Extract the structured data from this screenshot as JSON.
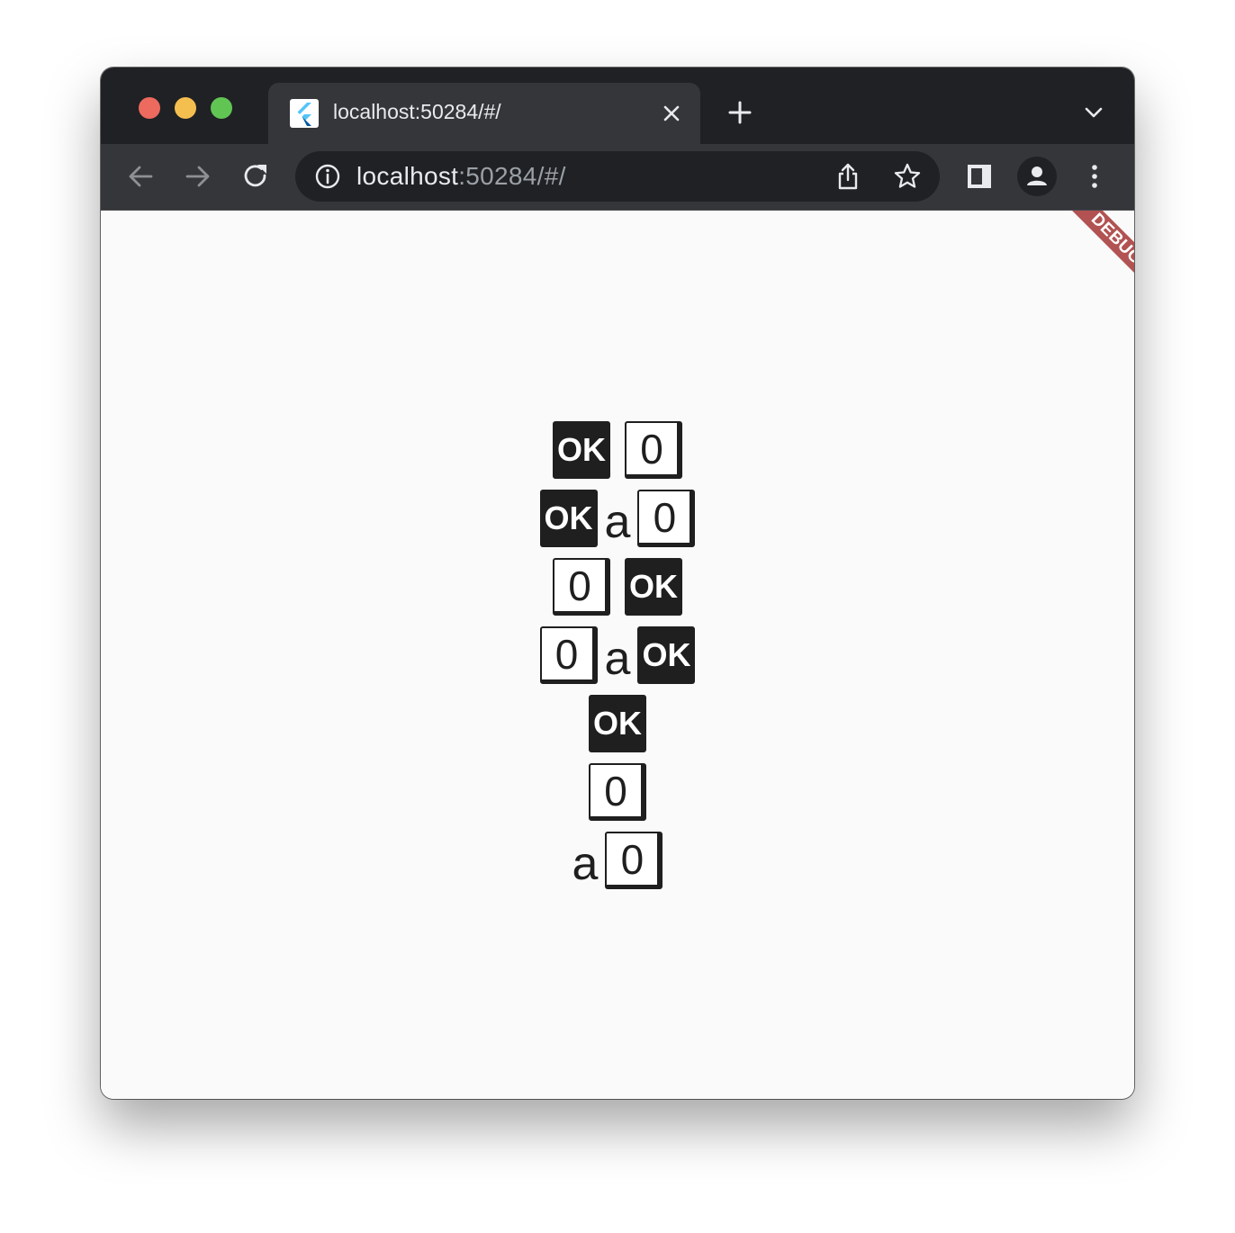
{
  "browser": {
    "tab_title": "localhost:50284/#/",
    "url_host": "localhost",
    "url_rest": ":50284/#/",
    "debug_banner": "DEBUG"
  },
  "rows": [
    {
      "items": [
        {
          "kind": "ok",
          "text": "OK"
        },
        {
          "kind": "zero",
          "text": "0"
        }
      ]
    },
    {
      "items": [
        {
          "kind": "ok",
          "text": "OK"
        },
        {
          "kind": "letter",
          "text": "a"
        },
        {
          "kind": "zero",
          "text": "0"
        }
      ]
    },
    {
      "items": [
        {
          "kind": "zero",
          "text": "0"
        },
        {
          "kind": "ok",
          "text": "OK"
        }
      ]
    },
    {
      "items": [
        {
          "kind": "zero",
          "text": "0"
        },
        {
          "kind": "letter",
          "text": "a"
        },
        {
          "kind": "ok",
          "text": "OK"
        }
      ]
    },
    {
      "items": [
        {
          "kind": "ok",
          "text": "OK"
        }
      ]
    },
    {
      "items": [
        {
          "kind": "zero",
          "text": "0"
        }
      ]
    },
    {
      "items": [
        {
          "kind": "letter",
          "text": "a"
        },
        {
          "kind": "zero",
          "text": "0"
        }
      ]
    }
  ],
  "icons": {
    "favicon": "flutter-logo-icon",
    "tab_close": "close-icon",
    "new_tab": "plus-icon",
    "tab_list": "chevron-down-icon",
    "back": "arrow-left-icon",
    "forward": "arrow-right-icon",
    "reload": "reload-icon",
    "site_info": "info-icon",
    "share": "share-icon",
    "bookmark": "star-icon",
    "side_panel": "side-panel-icon",
    "profile": "profile-icon",
    "menu": "kebab-menu-icon"
  }
}
